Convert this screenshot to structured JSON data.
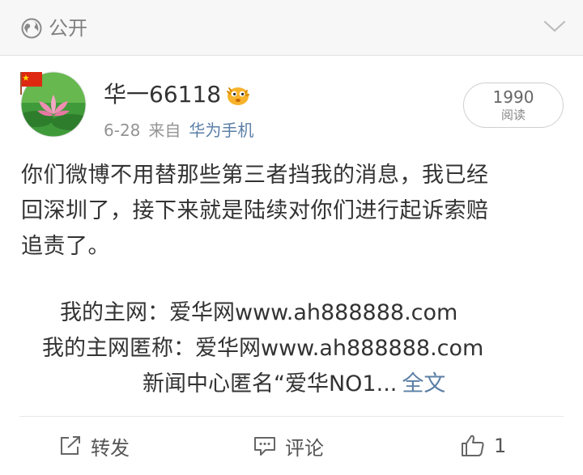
{
  "visibility": {
    "label": "公开",
    "icon": "globe-icon"
  },
  "post": {
    "author": "华一66118",
    "date": "6-28",
    "via": "来自",
    "source": "华为手机",
    "reads": {
      "count": "1990",
      "label": "阅读"
    },
    "paragraph": [
      "你们微博不用替那些第三者挡我的消息，我已经",
      "回深圳了，接下来就是陆续对你们进行起诉索赔",
      "追责了。"
    ],
    "line1": "我的主网：爱华网www.ah888888.com",
    "line2": "我的主网匿称：爱华网www.ah888888.com",
    "line3": "新闻中心匿名“爱华NO1...",
    "more_link": "全文"
  },
  "actions": {
    "repost": "转发",
    "comment": "评论",
    "like_count": "1"
  },
  "colors": {
    "link": "#5b7fa6",
    "text": "#333333",
    "muted": "#939393"
  }
}
